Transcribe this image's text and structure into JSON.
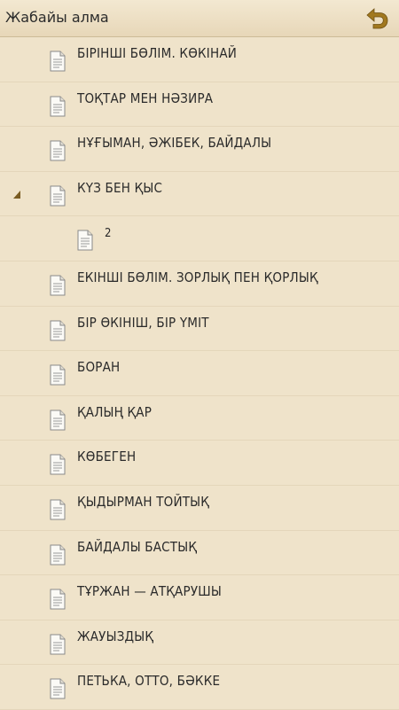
{
  "header": {
    "title": "Жабайы алма",
    "back_icon": "back-arrow-icon",
    "accent": "#a1781f"
  },
  "toc": {
    "items": [
      {
        "label": "БІРІНШІ БӨЛІМ. КӨКІНАЙ",
        "level": 0,
        "expanded": false
      },
      {
        "label": "ТОҚТАР МЕН НӘЗИРА",
        "level": 0,
        "expanded": false
      },
      {
        "label": "НҰҒЫМАН, ӘЖІБЕК, БАЙДАЛЫ",
        "level": 0,
        "expanded": false
      },
      {
        "label": "КҮЗ БЕН ҚЫС",
        "level": 0,
        "expanded": true
      },
      {
        "label": "2",
        "level": 1,
        "expanded": false
      },
      {
        "label": "ЕКІНШІ БӨЛІМ. ЗОРЛЫҚ ПЕН ҚОРЛЫҚ",
        "level": 0,
        "expanded": false
      },
      {
        "label": "БІР ӨКІНІШ, БІР ҮМІТ",
        "level": 0,
        "expanded": false
      },
      {
        "label": "БОРАН",
        "level": 0,
        "expanded": false
      },
      {
        "label": "ҚАЛЫҢ ҚАР",
        "level": 0,
        "expanded": false
      },
      {
        "label": "КӨБЕГЕН",
        "level": 0,
        "expanded": false
      },
      {
        "label": "ҚЫДЫРМАН ТОЙТЫҚ",
        "level": 0,
        "expanded": false
      },
      {
        "label": "БАЙДАЛЫ БАСТЫҚ",
        "level": 0,
        "expanded": false
      },
      {
        "label": "ТҰРЖАН — АТҚАРУШЫ",
        "level": 0,
        "expanded": false
      },
      {
        "label": "ЖАУЫЗДЫҚ",
        "level": 0,
        "expanded": false
      },
      {
        "label": "ПЕТЬКА, ОТТО, БӘККЕ",
        "level": 0,
        "expanded": false
      }
    ],
    "item_icon": "document-icon",
    "expander_icon": "expanded-triangle-icon"
  }
}
